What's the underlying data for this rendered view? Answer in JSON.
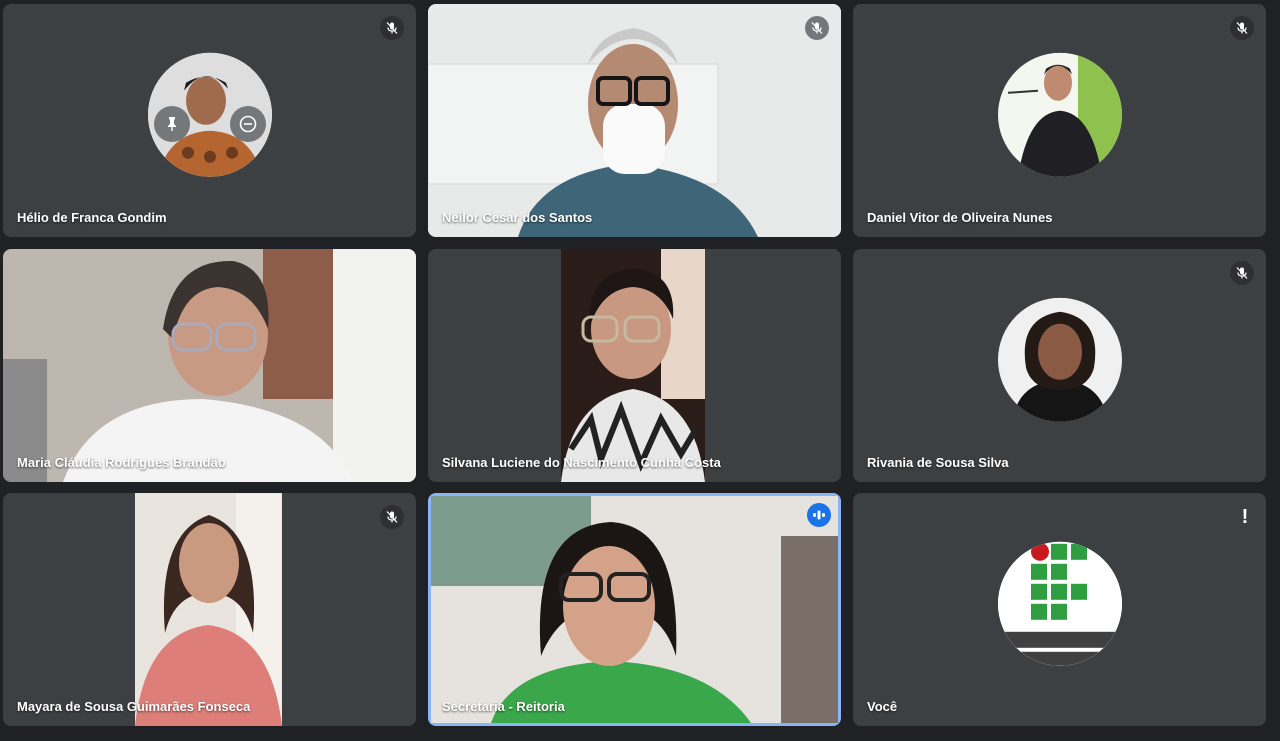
{
  "participants": [
    {
      "name": "Hélio de Franca Gondim",
      "muted": true,
      "kind": "avatar"
    },
    {
      "name": "Neilor Cesar dos Santos",
      "muted": true,
      "kind": "video"
    },
    {
      "name": "Daniel Vitor de Oliveira Nunes",
      "muted": true,
      "kind": "avatar"
    },
    {
      "name": "Maria Cláudia Rodrigues Brandão",
      "muted": false,
      "kind": "video"
    },
    {
      "name": "Silvana Luciene do Nascimento Cunha Costa",
      "muted": false,
      "kind": "video"
    },
    {
      "name": "Rivania de Sousa Silva",
      "muted": true,
      "kind": "avatar"
    },
    {
      "name": "Mayara de Sousa Guimarães Fonseca",
      "muted": true,
      "kind": "video"
    },
    {
      "name": "Secretaria - Reitoria",
      "muted": false,
      "speaking": true,
      "kind": "video"
    },
    {
      "name": "Você",
      "muted": false,
      "alert": true,
      "kind": "avatar"
    }
  ],
  "icons": {
    "mute": "mic-off-icon",
    "speaking": "audio-level-icon",
    "pin": "pin-icon",
    "remove": "remove-icon",
    "alert": "alert-icon"
  },
  "colors": {
    "background": "#202124",
    "tile": "#3c4043",
    "accent": "#1a73e8",
    "active_border": "#8ab4f8",
    "if_green": "#2f9e41",
    "if_red": "#c8191e"
  }
}
